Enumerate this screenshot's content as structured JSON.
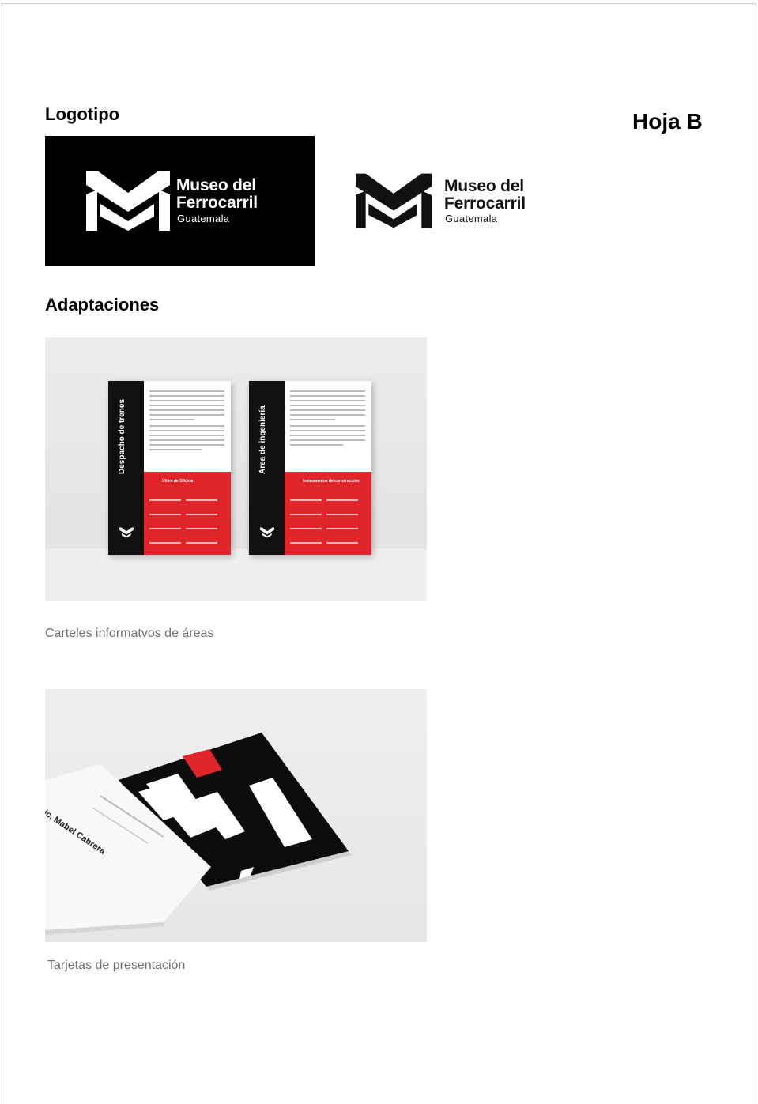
{
  "sheet": {
    "label": "Hoja B"
  },
  "sections": {
    "logo": {
      "title": "Logotipo"
    },
    "adaptations": {
      "title": "Adaptaciones"
    }
  },
  "logo": {
    "name_line1": "Museo del",
    "name_line2": "Ferrocarril",
    "place": "Guatemala"
  },
  "adaptations": [
    {
      "caption": "Carteles informatvos de áreas"
    },
    {
      "caption": "Tarjetas de presentación"
    }
  ],
  "posters": [
    {
      "vertical_title": "Despacho de trenes",
      "red_title": "Útiles de Oficina"
    },
    {
      "vertical_title": "Área de ingeniería",
      "red_title": "Instrumentos de construcción"
    }
  ],
  "business_card": {
    "name": "Lic. Mabel Cabrera"
  },
  "colors": {
    "brand_black": "#111111",
    "brand_red": "#e0262a",
    "caption_gray": "#6f6f6f"
  }
}
